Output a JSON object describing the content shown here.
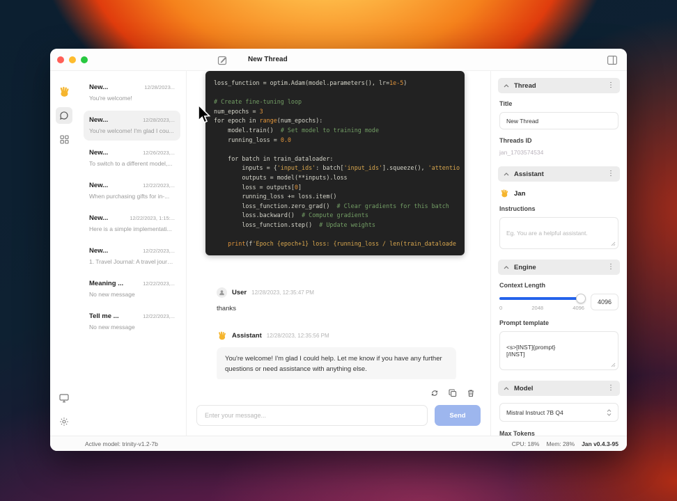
{
  "window": {
    "title": "New Thread"
  },
  "icons": {
    "compose": "pencil-square",
    "panel_toggle": "sidebar-rect",
    "jan_logo": "wave-hand",
    "chat": "speech-bubble",
    "apps": "grid-squares",
    "system_monitor": "monitor",
    "settings": "gear",
    "user_avatar": "person",
    "regenerate": "circular-arrows",
    "copy": "overlapping-squares",
    "delete": "trash-can",
    "collapse": "chevron-up",
    "menu": "vertical-dots",
    "select_stepper": "up-down-chevrons"
  },
  "thread_list": {
    "items": [
      {
        "title": "New...",
        "date": "12/28/2023...",
        "preview": "You're welcome!",
        "selected": false
      },
      {
        "title": "New...",
        "date": "12/28/2023,...",
        "preview": "You're welcome! I'm glad I cou...",
        "selected": true
      },
      {
        "title": "New...",
        "date": "12/26/2023,...",
        "preview": "To switch to a different model,...",
        "selected": false
      },
      {
        "title": "New...",
        "date": "12/22/2023,...",
        "preview": "When purchasing gifts for in-...",
        "selected": false
      },
      {
        "title": "New...",
        "date": "12/22/2023, 1:15:...",
        "preview": "Here is a simple implementati...",
        "selected": false
      },
      {
        "title": "New...",
        "date": "12/22/2023,...",
        "preview": "1. Travel Journal: A travel journ...",
        "selected": false
      },
      {
        "title": "Meaning ...",
        "date": "12/22/2023,...",
        "preview": "No new message",
        "selected": false
      },
      {
        "title": "Tell me ...",
        "date": "12/22/2023,...",
        "preview": "No new message",
        "selected": false
      }
    ]
  },
  "chat": {
    "code_lines": [
      [
        [
          "loss_function = optim.Adam(model.parameters(), lr=",
          "d"
        ],
        [
          "1e-5",
          "n"
        ],
        [
          ")",
          "d"
        ]
      ],
      [],
      [
        [
          "# Create fine-tuning loop",
          "c"
        ]
      ],
      [
        [
          "num_epochs = ",
          "d"
        ],
        [
          "3",
          "n"
        ]
      ],
      [
        [
          "for epoch in ",
          "d"
        ],
        [
          "range",
          "n"
        ],
        [
          "(num_epochs):",
          "d"
        ]
      ],
      [
        [
          "    model.train()  ",
          "d"
        ],
        [
          "# Set model to training mode",
          "c"
        ]
      ],
      [
        [
          "    running_loss = ",
          "d"
        ],
        [
          "0.0",
          "n"
        ]
      ],
      [],
      [
        [
          "    for batch in train_dataloader:",
          "d"
        ]
      ],
      [
        [
          "        inputs = {",
          "d"
        ],
        [
          "'input_ids'",
          "s"
        ],
        [
          ": batch[",
          "d"
        ],
        [
          "'input_ids'",
          "s"
        ],
        [
          "].squeeze(), ",
          "d"
        ],
        [
          "'attentio",
          "s"
        ]
      ],
      [
        [
          "        outputs = model(**inputs).loss",
          "d"
        ]
      ],
      [
        [
          "        loss = outputs[",
          "d"
        ],
        [
          "0",
          "n"
        ],
        [
          "]",
          "d"
        ]
      ],
      [
        [
          "        running_loss += loss.item()",
          "d"
        ]
      ],
      [
        [
          "        loss_function.zero_grad()  ",
          "d"
        ],
        [
          "# Clear gradients for this batch",
          "c"
        ]
      ],
      [
        [
          "        loss.backward()  ",
          "d"
        ],
        [
          "# Compute gradients",
          "c"
        ]
      ],
      [
        [
          "        loss_function.step()  ",
          "d"
        ],
        [
          "# Update weights",
          "c"
        ]
      ],
      [],
      [
        [
          "    ",
          "d"
        ],
        [
          "print",
          "n"
        ],
        [
          "(f",
          "d"
        ],
        [
          "'Epoch {epoch+1} loss: {running_loss / len(train_dataloade",
          "s"
        ]
      ]
    ],
    "messages": [
      {
        "role": "User",
        "timestamp": "12/28/2023, 12:35:47 PM",
        "text": "thanks"
      },
      {
        "role": "Assistant",
        "timestamp": "12/28/2023, 12:35:56 PM",
        "text": "You're welcome! I'm glad I could help. Let me know if you have any further questions or need assistance with anything else."
      }
    ],
    "input_placeholder": "Enter your message...",
    "send_label": "Send"
  },
  "right_panel": {
    "thread": {
      "title": "Thread",
      "title_label": "Title",
      "title_value": "New Thread",
      "threads_id_label": "Threads ID",
      "threads_id_value": "jan_1703574534"
    },
    "assistant": {
      "title": "Assistant",
      "name": "Jan",
      "instructions_label": "Instructions",
      "instructions_placeholder": "Eg. You are a helpful assistant."
    },
    "engine": {
      "title": "Engine",
      "context_length_label": "Context Length",
      "ticks": [
        "0",
        "2048",
        "4096"
      ],
      "context_value": "4096",
      "prompt_template_label": "Prompt template",
      "prompt_template_value": "<s>[INST]{prompt}\n[/INST]"
    },
    "model": {
      "title": "Model",
      "model_value": "Mistral Instruct 7B Q4",
      "max_tokens_label": "Max Tokens"
    }
  },
  "status_bar": {
    "active_model": "Active model: trinity-v1.2-7b",
    "cpu": "CPU: 18%",
    "mem": "Mem: 28%",
    "version": "Jan v0.4.3-95"
  },
  "colors": {
    "accent_blue": "#2563eb",
    "send_blue": "#9db6ee",
    "code_bg": "#222222",
    "brand_yellow": "#f5b52e"
  }
}
